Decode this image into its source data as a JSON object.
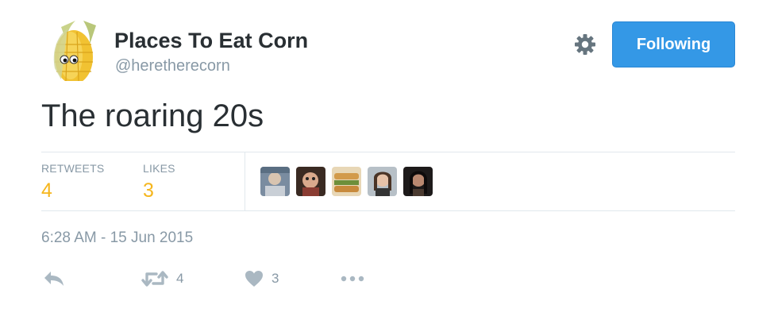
{
  "tweet": {
    "display_name": "Places To Eat Corn",
    "handle": "@heretherecorn",
    "follow_label": "Following",
    "text": "The roaring 20s",
    "timestamp": "6:28 AM - 15 Jun 2015"
  },
  "stats": [
    {
      "label": "RETWEETS",
      "value": "4"
    },
    {
      "label": "LIKES",
      "value": "3"
    }
  ],
  "likers": [
    {
      "icon": "liker-avatar-1"
    },
    {
      "icon": "liker-avatar-2"
    },
    {
      "icon": "liker-avatar-3"
    },
    {
      "icon": "liker-avatar-4"
    },
    {
      "icon": "liker-avatar-5"
    }
  ],
  "actions": {
    "reply_icon": "reply-icon",
    "retweet_icon": "retweet-icon",
    "retweet_count": "4",
    "like_icon": "heart-icon",
    "like_count": "3",
    "more_icon": "more-dots-icon"
  },
  "colors": {
    "follow_button": "#3498e6",
    "stat_value": "#f5b61d",
    "muted_text": "#8899a6",
    "icon_gray": "#aab8c2",
    "gear_gray": "#66757f"
  }
}
